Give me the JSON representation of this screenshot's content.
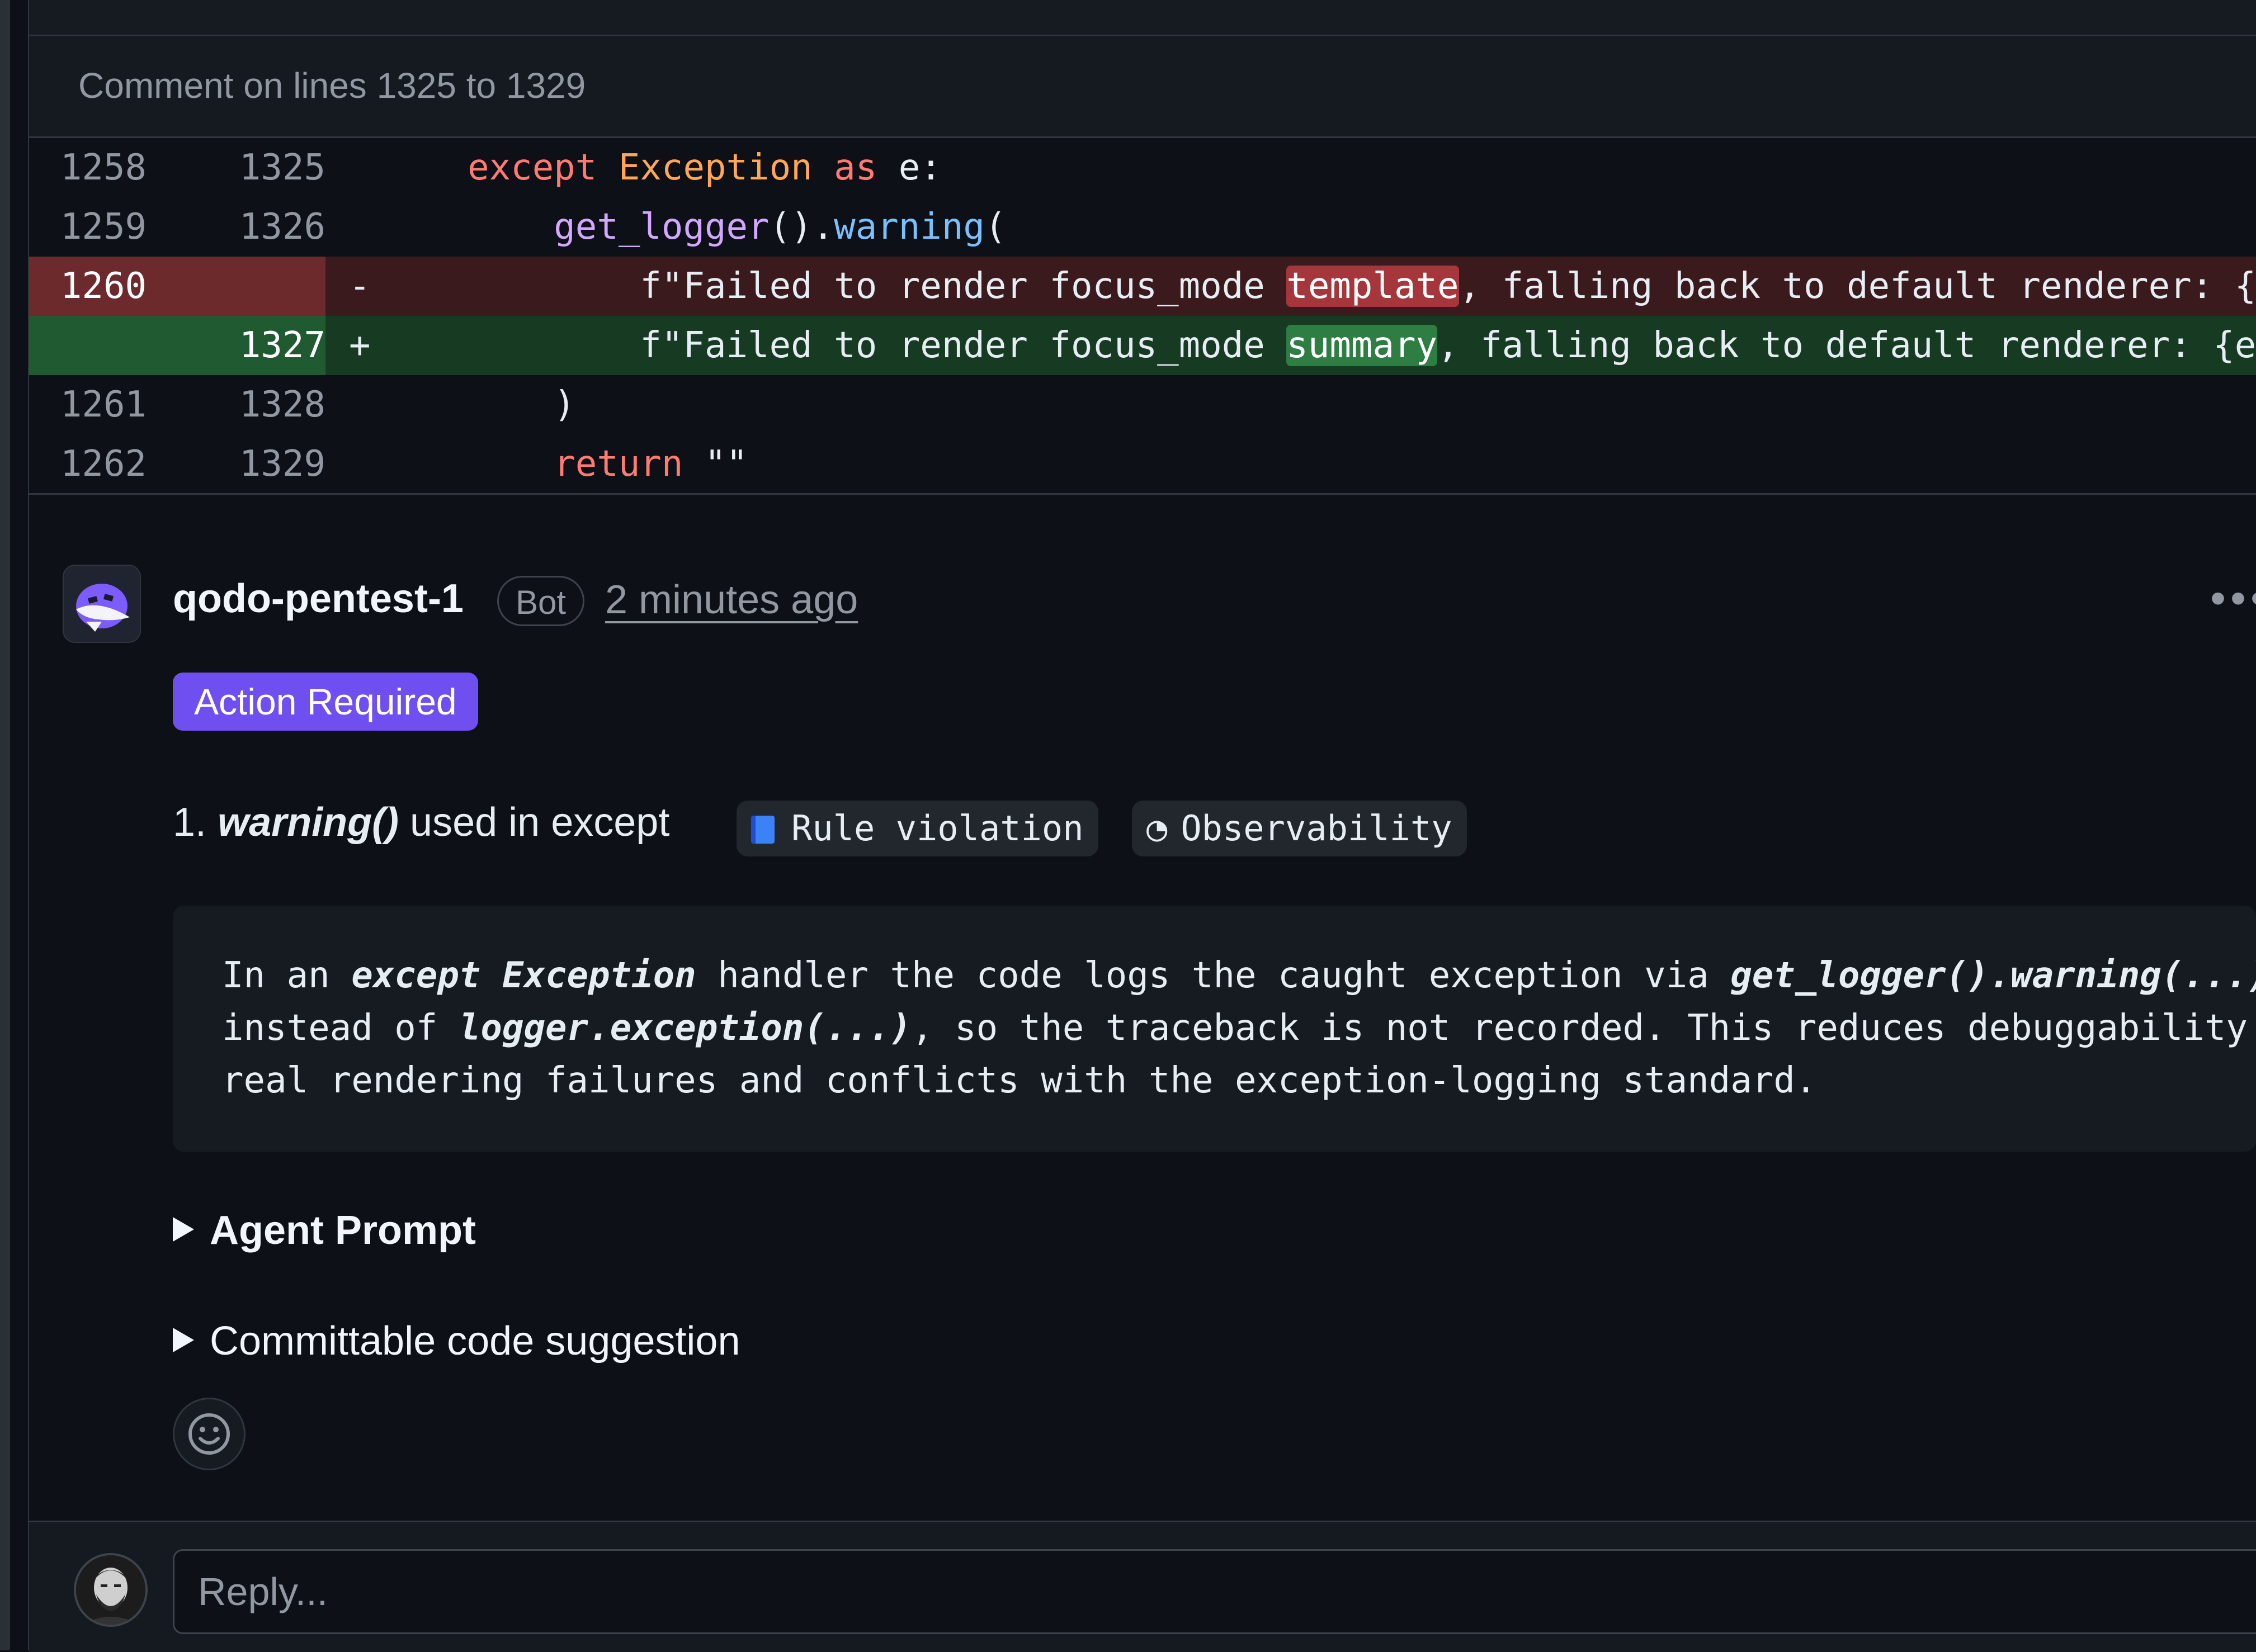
{
  "comment_header": "Comment on lines 1325 to 1329",
  "diff": {
    "r1": {
      "old": "1258",
      "new": "1325",
      "kw1": "except",
      "cls": "Exception",
      "kw2": "as",
      "rest": " e:"
    },
    "r2": {
      "old": "1259",
      "new": "1326",
      "fn": "get_logger",
      "mid": "().",
      "mth": "warning",
      "end": "("
    },
    "r3": {
      "old": "1260",
      "new": "",
      "sign": "-",
      "pre": "f\"Failed to render focus_mode ",
      "hl": "template",
      "post": ", falling back to default renderer: {e"
    },
    "r4": {
      "old": "",
      "new": "1327",
      "sign": "+",
      "pre": "f\"Failed to render focus_mode ",
      "hl": "summary",
      "post": ", falling back to default renderer: {e}"
    },
    "r5": {
      "old": "1261",
      "new": "1328",
      "code": ")"
    },
    "r6": {
      "old": "1262",
      "new": "1329",
      "kw": "return",
      "str": " \"\""
    }
  },
  "comment": {
    "author": "qodo-pentest-1",
    "badge": "Bot",
    "time": "2 minutes ago",
    "more": "•••",
    "status": "Action Required",
    "issue_num": "1. ",
    "issue_title": "warning()",
    "issue_rest": " used in except",
    "tags": {
      "rule": "Rule violation",
      "observability": "Observability",
      "clock_glyph": "◔"
    },
    "desc": {
      "l1a": "In an ",
      "l1b": "except Exception",
      "l1c": " handler the code logs the caught exception via ",
      "l1d": "get_logger().warning(...)",
      "l2a": "instead of ",
      "l2b": "logger.exception(...)",
      "l2c": ", so the traceback is not recorded. This reduces debuggability for",
      "l3": "real rendering failures and conflicts with the exception-logging standard."
    },
    "agent_prompt": "Agent Prompt",
    "code_suggestion": "Committable code suggestion"
  },
  "reply": {
    "placeholder": "Reply..."
  },
  "colors": {
    "accent_purple": "#6f4ff0",
    "deleted": "#6d2a2d",
    "added": "#1f5a31",
    "background": "#0d1117"
  }
}
